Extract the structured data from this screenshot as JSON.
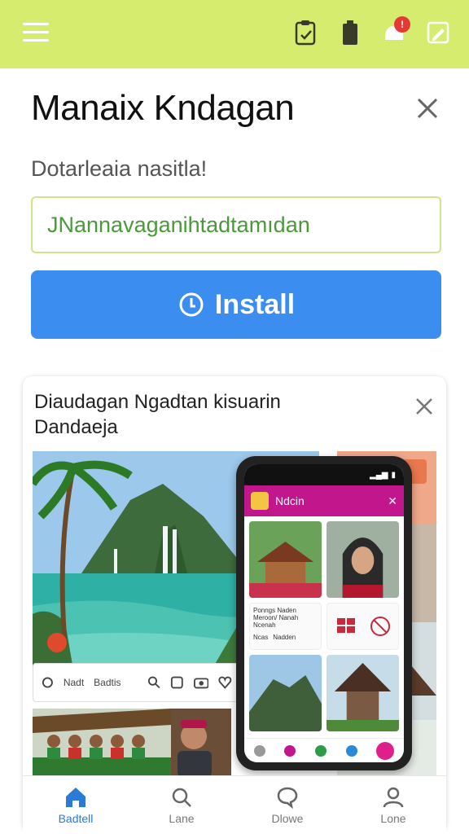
{
  "header": {
    "icons": [
      "clipboard-icon",
      "battery-icon",
      "notification-bell-icon",
      "edit-icon"
    ],
    "notification_badge": "!"
  },
  "main": {
    "title": "Manaix Kndagan",
    "subtitle": "Dotarleaia nasitla!",
    "input_value": "JNannavaganihtadtamıdan",
    "install_label": "Install"
  },
  "card": {
    "title_line1": "Diaudagan Ngadtan kisuarin",
    "title_line2": "Dandaeja",
    "strip_labels": [
      "Nadt",
      "Badtis"
    ],
    "phone": {
      "app_name": "Ndcin",
      "info_lines": [
        "Ponngs Naden",
        "Meroon/ Nanah",
        "Ncenah"
      ],
      "info_tags": [
        "Ncas",
        "Nadden"
      ]
    }
  },
  "bottom_nav": [
    {
      "label": "Badtell",
      "icon": "home-icon",
      "active": true
    },
    {
      "label": "Lane",
      "icon": "search-icon",
      "active": false
    },
    {
      "label": "Dlowe",
      "icon": "chat-icon",
      "active": false
    },
    {
      "label": "Lone",
      "icon": "profile-icon",
      "active": false
    }
  ],
  "colors": {
    "topbar": "#d6ec6e",
    "install": "#3b8ef0",
    "phone_header": "#c2168c",
    "nav_active": "#2a7ad6"
  }
}
